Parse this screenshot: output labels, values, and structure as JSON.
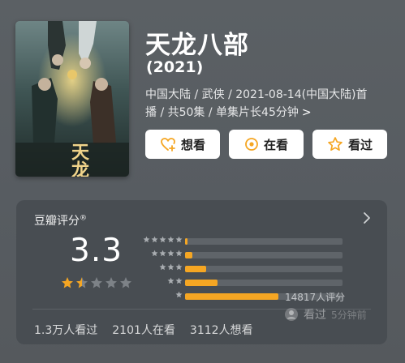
{
  "show": {
    "title": "天龙八部",
    "year": "(2021)",
    "meta_line1": "中国大陆 / 武侠 / 2021-08-14(中国大陆)首",
    "meta_line2": "播 / 共50集 / 单集片长45分钟",
    "meta_chevron": ">",
    "poster_title": "天龙八部"
  },
  "actions": {
    "want_label": "想看",
    "watching_label": "在看",
    "watched_label": "看过"
  },
  "rating": {
    "heading": "豆瓣评分",
    "heading_mark": "®",
    "score": "3.3",
    "score_stars": 1.5,
    "distribution_percent": [
      1.2,
      4.5,
      13.5,
      20.5,
      59.5
    ],
    "rating_count": "14817人评分",
    "watched_count": "1.3万人看过",
    "watching_count": "2101人在看",
    "want_count": "3112人想看"
  },
  "watermark": {
    "label": "看过",
    "extra": "5分钟前"
  },
  "colors": {
    "accent": "#f5a623",
    "card_bg": "#484d52"
  }
}
